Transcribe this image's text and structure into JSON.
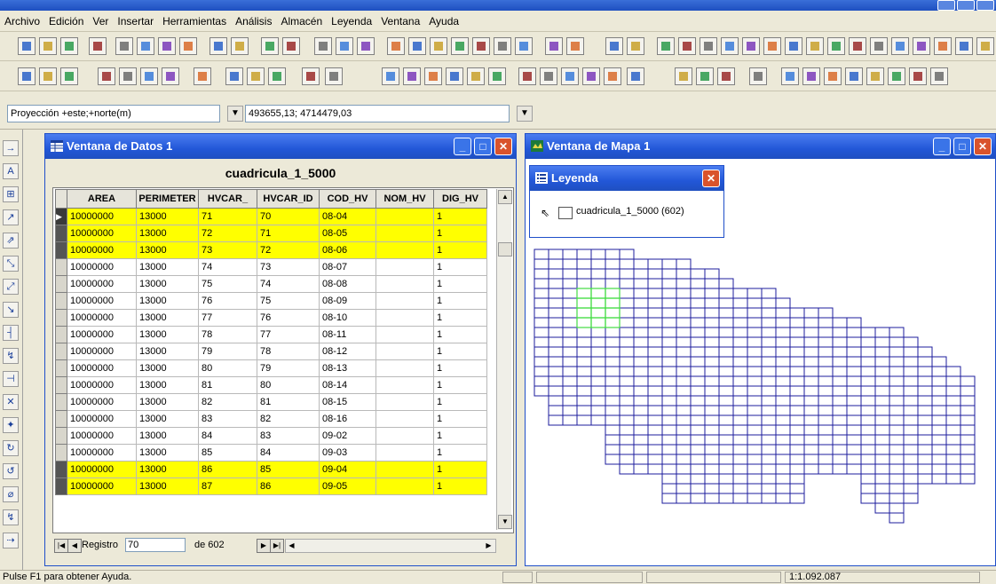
{
  "menus": [
    "Archivo",
    "Edición",
    "Ver",
    "Insertar",
    "Herramientas",
    "Análisis",
    "Almacén",
    "Leyenda",
    "Ventana",
    "Ayuda"
  ],
  "projection": {
    "label": "Proyección +este;+norte(m)",
    "coords": "493655,13; 4714479,03"
  },
  "data_window": {
    "title": "Ventana de Datos 1",
    "layer_title": "cuadricula_1_5000",
    "columns": [
      "AREA",
      "PERIMETER",
      "HVCAR_",
      "HVCAR_ID",
      "COD_HV",
      "NOM_HV",
      "DIG_HV"
    ],
    "rows": [
      {
        "area": "10000000",
        "perimeter": "13000",
        "hvcar": "71",
        "hvcar_id": "70",
        "cod": "08-04",
        "nom": "",
        "dig": "1",
        "highlight": true,
        "current": true
      },
      {
        "area": "10000000",
        "perimeter": "13000",
        "hvcar": "72",
        "hvcar_id": "71",
        "cod": "08-05",
        "nom": "",
        "dig": "1",
        "highlight": true
      },
      {
        "area": "10000000",
        "perimeter": "13000",
        "hvcar": "73",
        "hvcar_id": "72",
        "cod": "08-06",
        "nom": "",
        "dig": "1",
        "highlight": true
      },
      {
        "area": "10000000",
        "perimeter": "13000",
        "hvcar": "74",
        "hvcar_id": "73",
        "cod": "08-07",
        "nom": "",
        "dig": "1"
      },
      {
        "area": "10000000",
        "perimeter": "13000",
        "hvcar": "75",
        "hvcar_id": "74",
        "cod": "08-08",
        "nom": "",
        "dig": "1"
      },
      {
        "area": "10000000",
        "perimeter": "13000",
        "hvcar": "76",
        "hvcar_id": "75",
        "cod": "08-09",
        "nom": "",
        "dig": "1"
      },
      {
        "area": "10000000",
        "perimeter": "13000",
        "hvcar": "77",
        "hvcar_id": "76",
        "cod": "08-10",
        "nom": "",
        "dig": "1"
      },
      {
        "area": "10000000",
        "perimeter": "13000",
        "hvcar": "78",
        "hvcar_id": "77",
        "cod": "08-11",
        "nom": "",
        "dig": "1"
      },
      {
        "area": "10000000",
        "perimeter": "13000",
        "hvcar": "79",
        "hvcar_id": "78",
        "cod": "08-12",
        "nom": "",
        "dig": "1"
      },
      {
        "area": "10000000",
        "perimeter": "13000",
        "hvcar": "80",
        "hvcar_id": "79",
        "cod": "08-13",
        "nom": "",
        "dig": "1"
      },
      {
        "area": "10000000",
        "perimeter": "13000",
        "hvcar": "81",
        "hvcar_id": "80",
        "cod": "08-14",
        "nom": "",
        "dig": "1"
      },
      {
        "area": "10000000",
        "perimeter": "13000",
        "hvcar": "82",
        "hvcar_id": "81",
        "cod": "08-15",
        "nom": "",
        "dig": "1"
      },
      {
        "area": "10000000",
        "perimeter": "13000",
        "hvcar": "83",
        "hvcar_id": "82",
        "cod": "08-16",
        "nom": "",
        "dig": "1"
      },
      {
        "area": "10000000",
        "perimeter": "13000",
        "hvcar": "84",
        "hvcar_id": "83",
        "cod": "09-02",
        "nom": "",
        "dig": "1"
      },
      {
        "area": "10000000",
        "perimeter": "13000",
        "hvcar": "85",
        "hvcar_id": "84",
        "cod": "09-03",
        "nom": "",
        "dig": "1"
      },
      {
        "area": "10000000",
        "perimeter": "13000",
        "hvcar": "86",
        "hvcar_id": "85",
        "cod": "09-04",
        "nom": "",
        "dig": "1",
        "highlight": true
      },
      {
        "area": "10000000",
        "perimeter": "13000",
        "hvcar": "87",
        "hvcar_id": "86",
        "cod": "09-05",
        "nom": "",
        "dig": "1",
        "highlight": true
      }
    ],
    "nav": {
      "registro_label": "Registro",
      "record": "70",
      "of_label": "de 602"
    }
  },
  "map_window": {
    "title": "Ventana de Mapa 1",
    "legend": {
      "title": "Leyenda",
      "layer": "cuadricula_1_5000 (602)"
    },
    "grid_color": "#1c1c9c",
    "selected_color": "#44dd44"
  },
  "status": {
    "help": "Pulse F1 para obtener Ayuda.",
    "scale": "1:1.092.087"
  },
  "colors": {
    "highlight": "#ffff00",
    "title_bar": "#2257d8",
    "close_btn": "#d9532c"
  }
}
